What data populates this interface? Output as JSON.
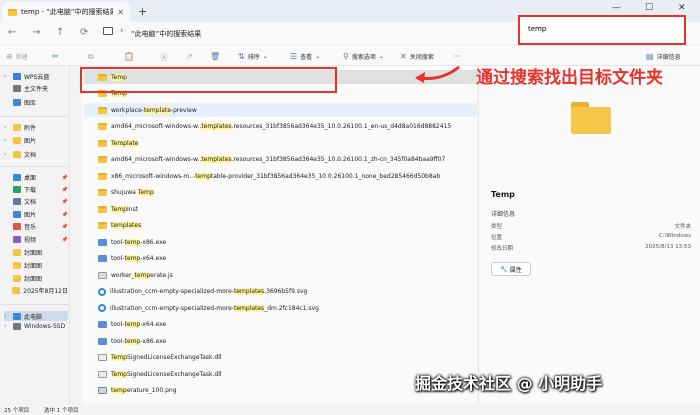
{
  "window": {
    "tab_title": "temp - “此电脑”中的搜索结果",
    "new_tab": "+",
    "minimize": "—",
    "maximize": "☐",
    "close": "✕"
  },
  "address": {
    "back": "←",
    "forward": "→",
    "up": "↑",
    "refresh": "⟳",
    "path": "“此电脑”中的搜索结果",
    "search_value": "temp"
  },
  "toolbar": {
    "new": "新建",
    "sort": "排序",
    "view": "查看",
    "search_options": "搜索选项",
    "close_search": "关闭搜索",
    "details": "详细信息"
  },
  "sidebar": {
    "items": [
      {
        "label": "WPS云盘",
        "icon": "cloud-icon",
        "color": "#3b7de0"
      },
      {
        "label": "主文件夹",
        "icon": "home-icon",
        "color": "#777"
      },
      {
        "label": "图库",
        "icon": "gallery-icon",
        "color": "#3b88d8"
      },
      {
        "label": "附件",
        "icon": "folder-icon",
        "color": "#f5c542"
      },
      {
        "label": "图片",
        "icon": "folder-icon",
        "color": "#f5c542"
      },
      {
        "label": "文档",
        "icon": "folder-icon",
        "color": "#f5c542"
      },
      {
        "label": "桌面",
        "icon": "desktop-icon",
        "color": "#3b88d8"
      },
      {
        "label": "下载",
        "icon": "download-icon",
        "color": "#2aa36a"
      },
      {
        "label": "文档",
        "icon": "documents-icon",
        "color": "#607d9a"
      },
      {
        "label": "图片",
        "icon": "pictures-icon",
        "color": "#3b88d8"
      },
      {
        "label": "音乐",
        "icon": "music-icon",
        "color": "#e2574c"
      },
      {
        "label": "视频",
        "icon": "video-icon",
        "color": "#8a5cc7"
      },
      {
        "label": "封面图",
        "icon": "folder-icon",
        "color": "#f5c542"
      },
      {
        "label": "封面图",
        "icon": "folder-icon",
        "color": "#f5c542"
      },
      {
        "label": "封面图",
        "icon": "folder-icon",
        "color": "#f5c542"
      },
      {
        "label": "2025年8月12日",
        "icon": "folder-icon",
        "color": "#f5c542"
      },
      {
        "label": "此电脑",
        "icon": "computer-icon",
        "color": "#3b88d8"
      },
      {
        "label": "Windows-SSD",
        "icon": "drive-icon",
        "color": "#777"
      }
    ]
  },
  "files": [
    {
      "type": "folder",
      "parts": [
        "",
        "Temp",
        ""
      ]
    },
    {
      "type": "folder",
      "parts": [
        "",
        "Temp",
        ""
      ]
    },
    {
      "type": "folder",
      "parts": [
        "workplace-",
        "template",
        "-preview"
      ]
    },
    {
      "type": "folder",
      "parts": [
        "amd64_microsoft-windows-w..",
        "templates",
        ".resources_31bf3856ad364e35_10.0.26100.1_en-us_d4d8a016d8882415"
      ]
    },
    {
      "type": "folder",
      "parts": [
        "",
        "Template",
        ""
      ]
    },
    {
      "type": "folder",
      "parts": [
        "amd64_microsoft-windows-w..",
        "templates",
        ".resources_31bf3856ad364e35_10.0.26100.1_zh-cn_345f0a84baa9ff07"
      ]
    },
    {
      "type": "folder",
      "parts": [
        "x86_microsoft-windows-m..-",
        "temp",
        "table-provider_31bf3856ad364e35_10.0.26100.1_none_bed285466d50b8ab"
      ]
    },
    {
      "type": "folder",
      "parts": [
        "shujuwa ",
        "Temp",
        ""
      ]
    },
    {
      "type": "folder",
      "parts": [
        "",
        "Temp",
        "Inst"
      ]
    },
    {
      "type": "folder",
      "parts": [
        "",
        "templates",
        ""
      ]
    },
    {
      "type": "exe",
      "parts": [
        "tool-",
        "temp",
        "-x86.exe"
      ]
    },
    {
      "type": "exe",
      "parts": [
        "tool-",
        "temp",
        "-x64.exe"
      ]
    },
    {
      "type": "js",
      "parts": [
        "worker_",
        "temp",
        "erate.js"
      ]
    },
    {
      "type": "svg",
      "parts": [
        "illustration_ccm-empty-specialized-more-",
        "templates",
        ".3696b5f9.svg"
      ]
    },
    {
      "type": "svg",
      "parts": [
        "illustration_ccm-empty-specialized-more-",
        "templates",
        "_dm.2fc184c1.svg"
      ]
    },
    {
      "type": "exe",
      "parts": [
        "tool-",
        "temp",
        "-x64.exe"
      ]
    },
    {
      "type": "exe",
      "parts": [
        "tool-",
        "temp",
        "-x86.exe"
      ]
    },
    {
      "type": "dll",
      "parts": [
        "",
        "Temp",
        "SignedLicenseExchangeTask.dll"
      ]
    },
    {
      "type": "dll",
      "parts": [
        "",
        "Temp",
        "SignedLicenseExchangeTask.dll"
      ]
    },
    {
      "type": "png",
      "parts": [
        "",
        "temp",
        "erature_100.png"
      ]
    }
  ],
  "annotation": "通过搜索找出目标文件夹",
  "details_pane": {
    "name": "Temp",
    "section": "详细信息",
    "rows": [
      {
        "k": "类型",
        "v": "文件夹"
      },
      {
        "k": "位置",
        "v": "C:\\Windows"
      },
      {
        "k": "修改日期",
        "v": "2025/8/13 13:53"
      }
    ],
    "properties": "属性"
  },
  "status": {
    "count": "25 个项目",
    "selected": "选中 1 个项目"
  },
  "watermark": "掘金技术社区 @ 小明助手",
  "colors": {
    "highlight": "#fff59c",
    "annotation": "#e8312a",
    "folder": "#f5c542"
  }
}
